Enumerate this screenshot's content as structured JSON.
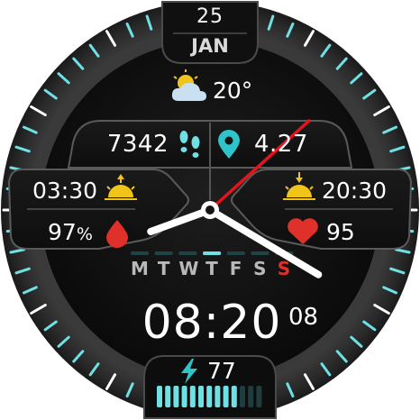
{
  "date": {
    "day": "25",
    "month": "JAN"
  },
  "weather": {
    "icon": "partly-cloudy-icon",
    "temperature": "20°"
  },
  "activity": {
    "steps": "7342",
    "steps_icon": "footsteps-icon",
    "distance": "4.27",
    "distance_icon": "location-pin-icon"
  },
  "sun": {
    "sunrise": "03:30",
    "sunset": "20:30",
    "sunrise_icon": "sunrise-icon",
    "sunset_icon": "sunset-icon"
  },
  "health": {
    "humidity": "97",
    "humidity_unit": "%",
    "humidity_icon": "water-drop-icon",
    "heart_rate": "95",
    "heart_icon": "heart-icon"
  },
  "week": {
    "days": [
      "M",
      "T",
      "W",
      "T",
      "F",
      "S",
      "S"
    ],
    "current_index": 3,
    "sunday_index": 6
  },
  "time": {
    "digital": "08:20",
    "seconds": "08",
    "hour": 8,
    "minute": 20,
    "second": 8
  },
  "battery": {
    "level": "77",
    "icon": "lightning-icon",
    "bars_total": 13,
    "bars_filled": 10
  },
  "colors": {
    "accent": "#6fe0e4",
    "second_hand": "#e3141c",
    "hands": "#ffffff",
    "sun": "#f0c419",
    "alert": "#e0302a",
    "bezel": "#2b2b2b",
    "face": "#0b0b0b"
  }
}
